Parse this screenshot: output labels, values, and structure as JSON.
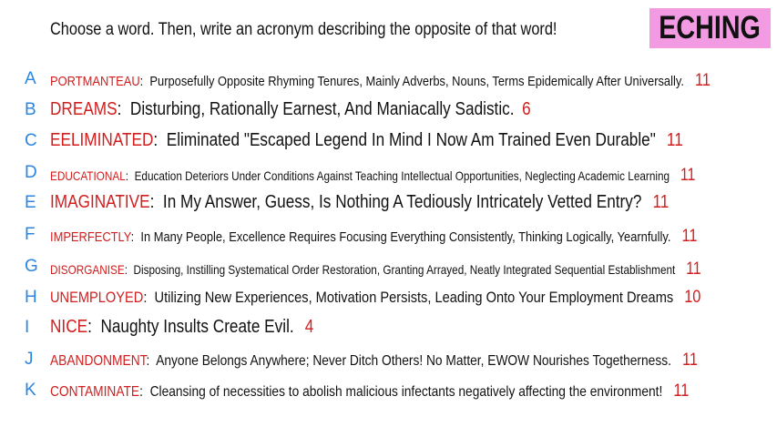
{
  "header": {
    "prompt": "Choose a word. Then, write an acronym describing the opposite of that word!",
    "badge": "ECHING"
  },
  "entries": [
    {
      "letter": "A",
      "word": "PORTMANTEAU",
      "acronym": "Purposefully Opposite Rhyming Tenures, Mainly Adverbs, Nouns, Terms Epidemically After Universally.",
      "count": "11"
    },
    {
      "letter": "B",
      "word": "DREAMS",
      "acronym": "Disturbing, Rationally Earnest, And Maniacally Sadistic.",
      "count": "6"
    },
    {
      "letter": "C",
      "word": "EELIMINATED",
      "acronym": "Eliminated \"Escaped Legend In Mind I Now Am Trained Even Durable\"",
      "count": "11"
    },
    {
      "letter": "D",
      "word": "EDUCATIONAL",
      "acronym": "Education Deteriors Under Conditions Against Teaching Intellectual Opportunities, Neglecting Academic Learning",
      "count": "11"
    },
    {
      "letter": "E",
      "word": "IMAGINATIVE",
      "acronym": "In My Answer, Guess, Is Nothing A Tediously Intricately Vetted Entry?",
      "count": "11"
    },
    {
      "letter": "F",
      "word": "IMPERFECTLY",
      "acronym": "In Many People, Excellence Requires Focusing Everything Consistently, Thinking Logically, Yearnfully.",
      "count": "11"
    },
    {
      "letter": "G",
      "word": "DISORGANISE",
      "acronym": "Disposing, Instilling Systematical Order Restoration, Granting Arrayed, Neatly Integrated Sequential Establishment",
      "count": "11"
    },
    {
      "letter": "H",
      "word": "UNEMPLOYED",
      "acronym": "Utilizing New Experiences, Motivation Persists, Leading Onto Your Employment Dreams",
      "count": "10"
    },
    {
      "letter": "I",
      "word": "NICE",
      "acronym": "Naughty Insults Create Evil.",
      "count": "4"
    },
    {
      "letter": "J",
      "word": "ABANDONMENT",
      "acronym": "Anyone Belongs Anywhere; Never Ditch Others! No Matter, EWOW Nourishes Togetherness.",
      "count": "11"
    },
    {
      "letter": "K",
      "word": "CONTAMINATE",
      "acronym": "Cleansing of necessities to abolish malicious infectants negatively affecting the environment!",
      "count": "11"
    }
  ]
}
